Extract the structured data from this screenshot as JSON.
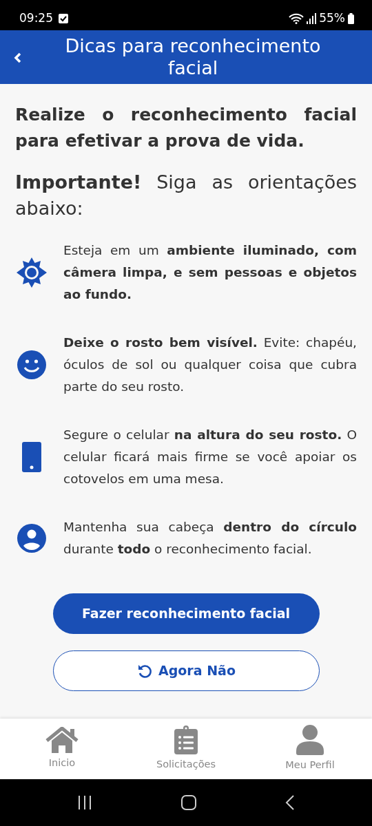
{
  "status_bar": {
    "time": "09:25",
    "battery": "55%"
  },
  "header": {
    "title": "Dicas para reconhecimento facial"
  },
  "headline": "Realize o reconhecimento facial para efetivar a prova de vida.",
  "intro": "**Importante!** Siga as orientações abaixo:",
  "tips": [
    {
      "kind": "sun",
      "text": "Esteja em um **ambiente iluminado, com câmera limpa, e sem pessoas e objetos ao fundo.**"
    },
    {
      "kind": "face",
      "text": "**Deixe o rosto bem visível.** Evite: chapéu, óculos de sol ou qualquer coisa que cubra parte do seu rosto."
    },
    {
      "kind": "phone",
      "text": "Segure o celular **na altura do seu rosto.** O celular ficará mais firme se você apoiar os cotovelos em uma mesa."
    },
    {
      "kind": "person",
      "text": "Mantenha sua cabeça **dentro do círculo** durante **todo** o reconhecimento facial."
    }
  ],
  "primary_button": "Fazer reconhecimento facial",
  "secondary_button": "Agora Não",
  "bottom_nav": [
    {
      "kind": "home",
      "label": "Inicio",
      "selected": false
    },
    {
      "kind": "clipboard",
      "label": "Solicitações",
      "selected": false
    },
    {
      "kind": "profile",
      "label": "Meu Perfil",
      "selected": false
    }
  ]
}
